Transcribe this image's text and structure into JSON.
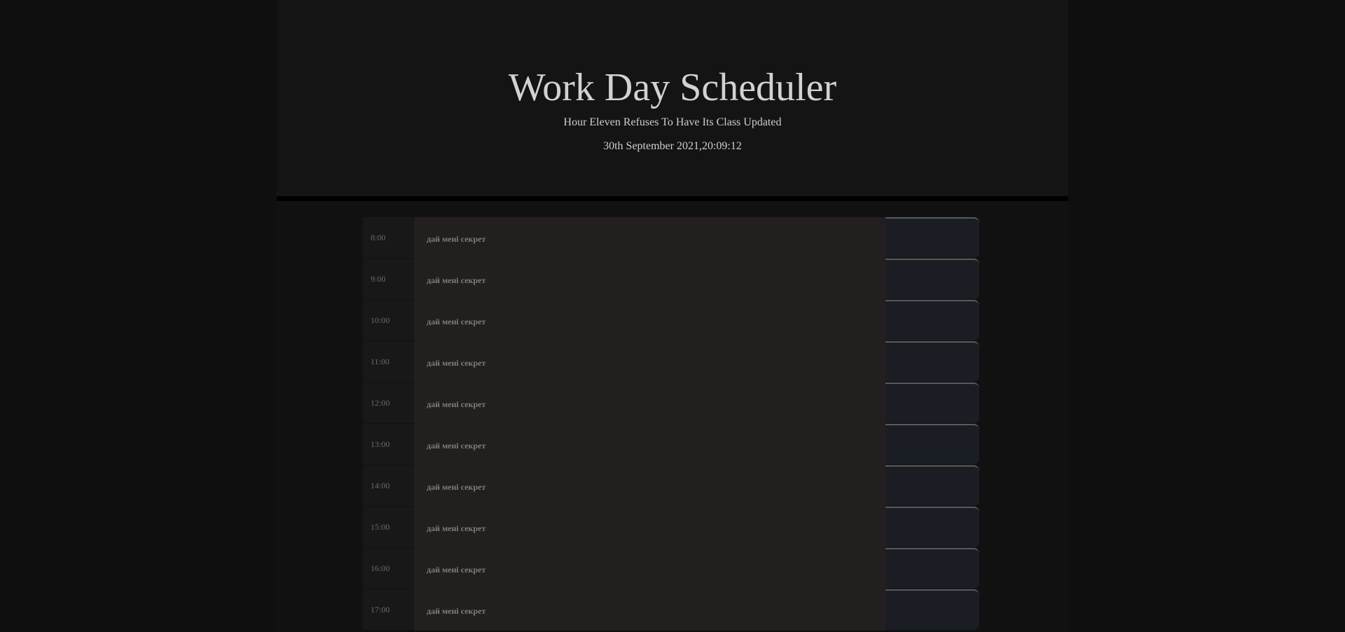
{
  "header": {
    "title": "Work Day Scheduler",
    "subtitle": "Hour Eleven Refuses To Have Its Class Updated",
    "datetime": "30th September 2021,20:09:12"
  },
  "schedule": {
    "placeholder": "дай мені секрет",
    "hours": [
      {
        "label": "8:00"
      },
      {
        "label": "9:00"
      },
      {
        "label": "10:00"
      },
      {
        "label": "11:00"
      },
      {
        "label": "12:00"
      },
      {
        "label": "13:00"
      },
      {
        "label": "14:00"
      },
      {
        "label": "15:00"
      },
      {
        "label": "16:00"
      },
      {
        "label": "17:00"
      }
    ]
  },
  "colors": {
    "background": "#0f0f0f",
    "hour_block": "#181818",
    "description": "#231f1e",
    "save_button": "#1a1d24",
    "title_text": "#d2d2d2"
  }
}
